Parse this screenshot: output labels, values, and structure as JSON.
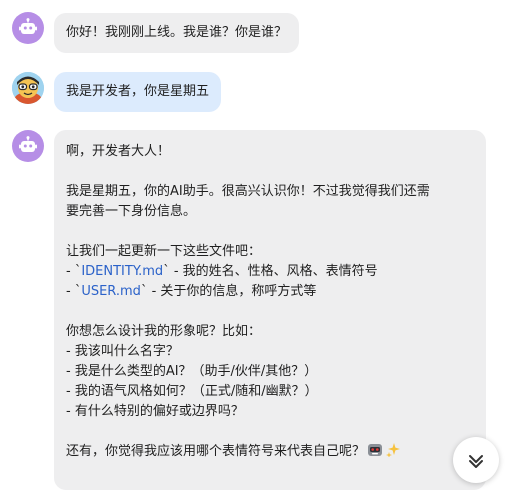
{
  "messages": [
    {
      "role": "assistant",
      "text": "你好！我刚刚上线。我是谁？你是谁？"
    },
    {
      "role": "user",
      "text": "我是开发者，你是星期五"
    },
    {
      "role": "assistant",
      "lines": {
        "greeting": "啊，开发者大人！",
        "intro_1": "我是星期五，你的AI助手。很高兴认识你！不过我觉得我们还需",
        "intro_2": "要完善一下身份信息。",
        "update_lead": "让我们一起更新一下这些文件吧：",
        "file1_prefix": "- `",
        "file1_name": "IDENTITY.md",
        "file1_desc": "` - 我的姓名、性格、风格、表情符号",
        "file2_prefix": "- `",
        "file2_name": "USER.md",
        "file2_desc": "` - 关于你的信息，称呼方式等",
        "design_q": "你想怎么设计我的形象呢？比如：",
        "q1": "- 我该叫什么名字？",
        "q2": "- 我是什么类型的AI？（助手/伙伴/其他？）",
        "q3": "- 我的语气风格如何？（正式/随和/幽默？）",
        "q4": "- 有什么特别的偏好或边界吗？",
        "closing": "还有，你觉得我应该用哪个表情符号来代表自己呢？"
      },
      "emojis": [
        "robot-emoji",
        "sparkles-emoji"
      ]
    }
  ],
  "colors": {
    "bot_avatar": "#b68ee6",
    "assistant_bubble": "#eeeeef",
    "user_bubble": "#dcebfd",
    "code_text": "#2b62c9"
  },
  "icons": [
    "robot-icon",
    "user-avatar-image",
    "chevron-down-icon"
  ]
}
